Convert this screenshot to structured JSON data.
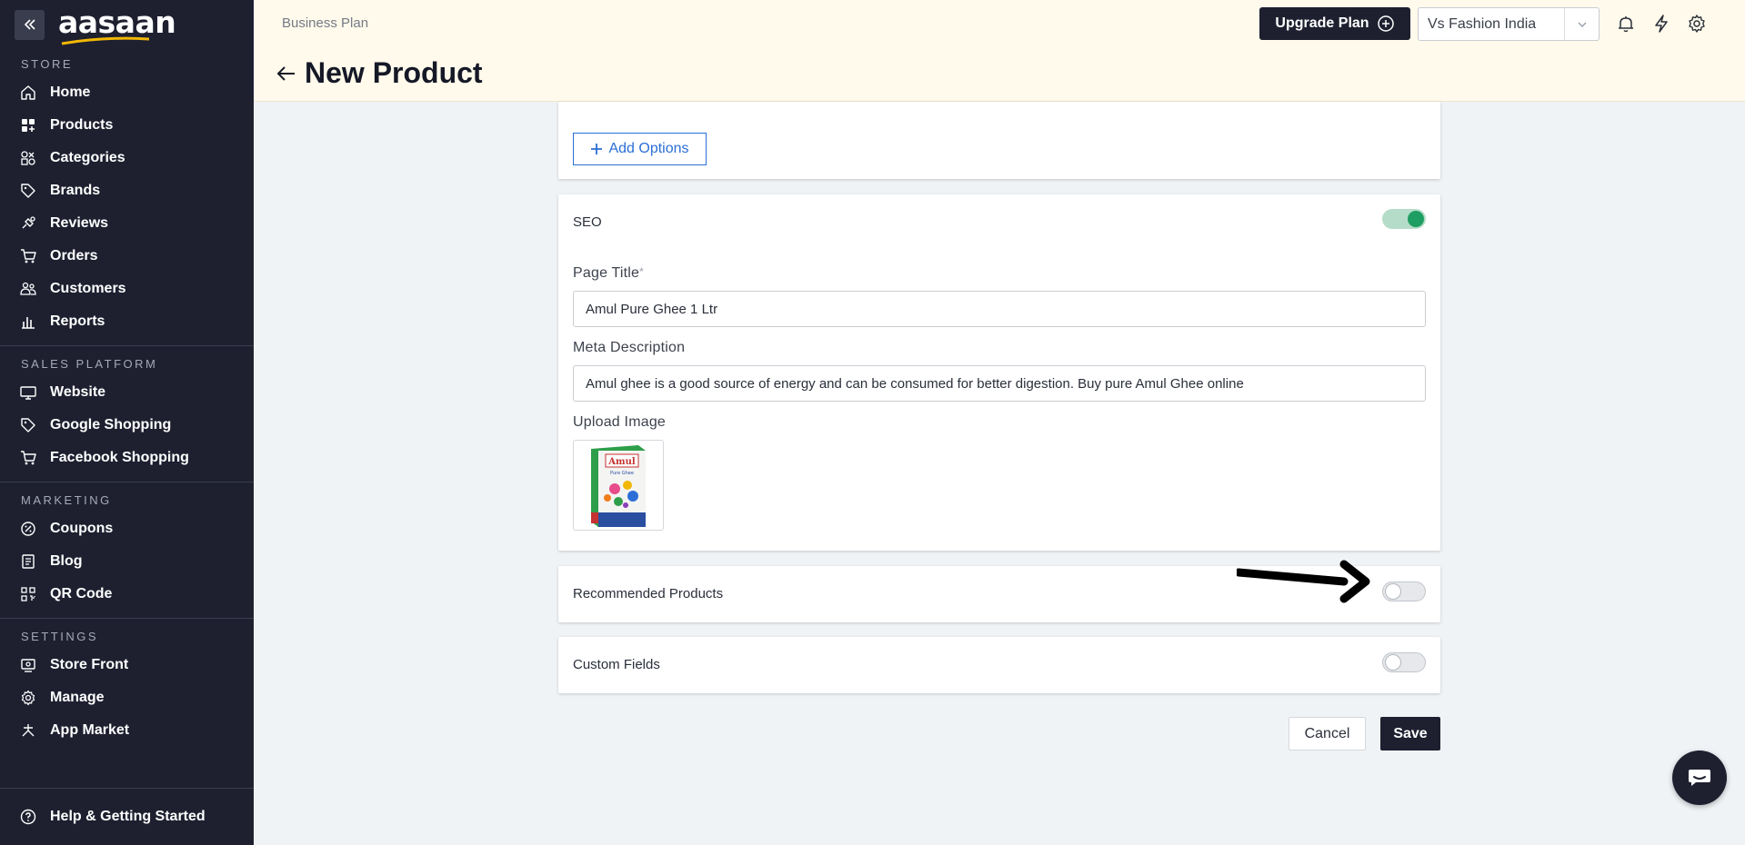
{
  "sidebar": {
    "logo": "aasaan",
    "sections": [
      {
        "title": "STORE",
        "items": [
          {
            "label": "Home",
            "icon": "home-icon"
          },
          {
            "label": "Products",
            "icon": "grid-icon"
          },
          {
            "label": "Categories",
            "icon": "categories-icon"
          },
          {
            "label": "Brands",
            "icon": "tag-icon"
          },
          {
            "label": "Reviews",
            "icon": "reviews-icon"
          },
          {
            "label": "Orders",
            "icon": "cart-icon"
          },
          {
            "label": "Customers",
            "icon": "users-icon"
          },
          {
            "label": "Reports",
            "icon": "bar-chart-icon"
          }
        ]
      },
      {
        "title": "SALES PLATFORM",
        "items": [
          {
            "label": "Website",
            "icon": "monitor-icon"
          },
          {
            "label": "Google Shopping",
            "icon": "tag-icon"
          },
          {
            "label": "Facebook Shopping",
            "icon": "cart-icon"
          }
        ]
      },
      {
        "title": "MARKETING",
        "items": [
          {
            "label": "Coupons",
            "icon": "coupon-icon"
          },
          {
            "label": "Blog",
            "icon": "blog-icon"
          },
          {
            "label": "QR Code",
            "icon": "qr-icon"
          }
        ]
      },
      {
        "title": "SETTINGS",
        "items": [
          {
            "label": "Store Front",
            "icon": "storefront-icon"
          },
          {
            "label": "Manage",
            "icon": "gear-icon"
          },
          {
            "label": "App Market",
            "icon": "app-market-icon"
          }
        ]
      }
    ],
    "help": "Help & Getting Started"
  },
  "header": {
    "plan": "Business Plan",
    "upgrade_label": "Upgrade Plan",
    "store_name": "Vs Fashion India",
    "page_title": "New Product"
  },
  "options_card": {
    "add_options_label": "Add Options"
  },
  "seo": {
    "title": "SEO",
    "enabled": true,
    "page_title_label": "Page Title",
    "page_title_required": "*",
    "page_title_value": "Amul Pure Ghee 1 Ltr",
    "meta_label": "Meta Description",
    "meta_value": "Amul ghee is a good source of energy and can be consumed for better digestion. Buy pure Amul Ghee online",
    "upload_label": "Upload Image",
    "image_brand": "Amul",
    "image_caption": "Pure Ghee"
  },
  "recommended": {
    "title": "Recommended Products",
    "enabled": false
  },
  "custom_fields": {
    "title": "Custom Fields",
    "enabled": false
  },
  "actions": {
    "cancel": "Cancel",
    "save": "Save"
  },
  "colors": {
    "sidebar": "#1e2030",
    "header": "#fffaeb",
    "accent": "#2b6fd6",
    "toggle_on": "#1f9e63"
  }
}
